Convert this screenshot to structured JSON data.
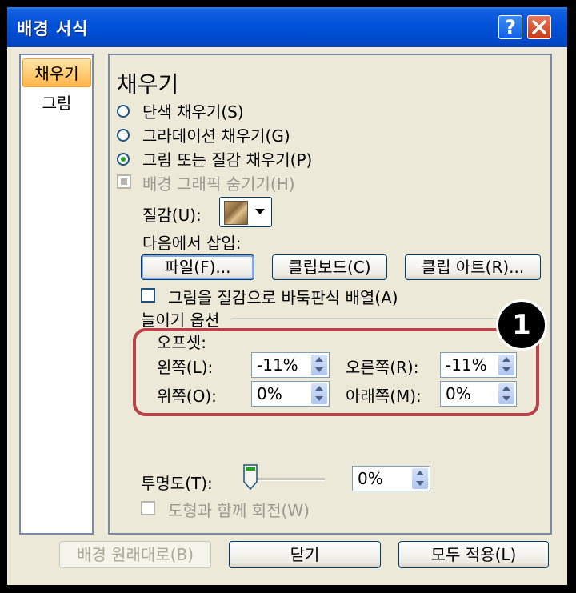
{
  "window": {
    "title": "배경 서식",
    "help_label": "?",
    "close_label": "✕"
  },
  "nav": {
    "items": [
      {
        "label": "채우기"
      },
      {
        "label": "그림"
      }
    ]
  },
  "fill": {
    "heading": "채우기",
    "radios": [
      {
        "label": "단색 채우기(S)",
        "checked": false
      },
      {
        "label": "그라데이션 채우기(G)",
        "checked": false
      },
      {
        "label": "그림 또는 질감 채우기(P)",
        "checked": true
      }
    ],
    "hide_graphics_label": "배경 그래픽 숨기기(H)",
    "texture_label": "질감(U):",
    "insert_from_label": "다음에서 삽입:",
    "file_button": "파일(F)...",
    "clipboard_button": "클립보드(C)",
    "clipart_button": "클립 아트(R)...",
    "tile_label": "그림을 질감으로 바둑판식 배열(A)",
    "stretch_label": "늘이기 옵션",
    "offset_label": "오프셋:",
    "offsets": {
      "left": {
        "label": "왼쪽(L):",
        "value": "-11%"
      },
      "right": {
        "label": "오른쪽(R):",
        "value": "-11%"
      },
      "top": {
        "label": "위쪽(O):",
        "value": "0%"
      },
      "bottom": {
        "label": "아래쪽(M):",
        "value": "0%"
      }
    },
    "transparency_label": "투명도(T):",
    "transparency_value": "0%",
    "transparency_level": 0,
    "rotate_label": "도형과 함께 회전(W)"
  },
  "callout": {
    "number": "1",
    "color": "#b8424a"
  },
  "footer": {
    "reset_button": "배경 원래대로(B)",
    "close_button": "닫기",
    "apply_all_button": "모두 적용(L)"
  }
}
